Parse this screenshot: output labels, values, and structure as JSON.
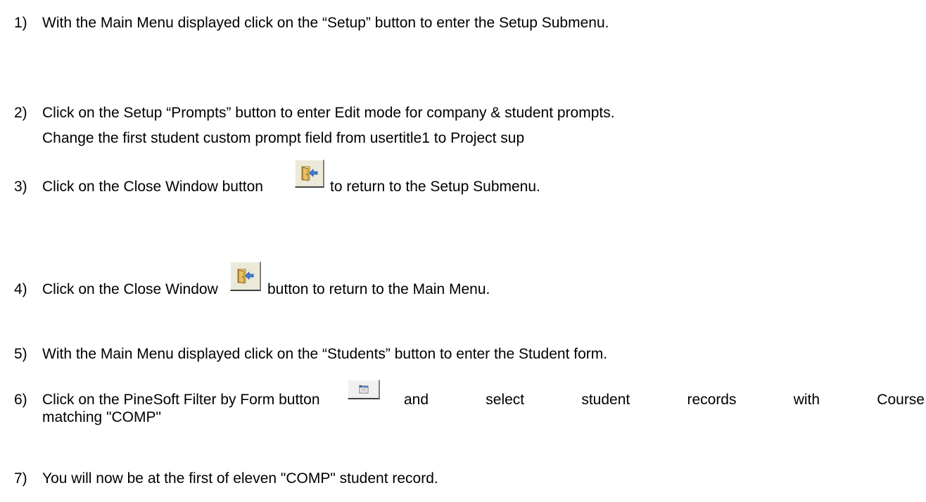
{
  "steps": [
    {
      "num": "1)",
      "text": "With the Main Menu displayed click on the “Setup” button to enter the Setup Submenu."
    },
    {
      "num": "2)",
      "text": "Click on the Setup  “Prompts” button to enter Edit mode for company & student prompts.",
      "text2": "Change the first student custom prompt field from  usertitle1  to Project sup"
    },
    {
      "num": "3)",
      "before": "Click on the Close Window button",
      "after": "to return to the Setup Submenu."
    },
    {
      "num": "4)",
      "before": "Click on the Close Window",
      "after": "button to return to the Main Menu."
    },
    {
      "num": "5)",
      "text": "With the Main Menu displayed click on the “Students” button to enter the Student form."
    },
    {
      "num": "6)",
      "before": "Click on the PineSoft Filter by Form button",
      "after": "and select student records with Course",
      "text2": "matching \"COMP\""
    },
    {
      "num": "7)",
      "text": "You will now be at the first of eleven \"COMP\" student record."
    }
  ],
  "icons": {
    "close_window": "close-window-icon",
    "filter_by_form": "filter-by-form-icon"
  }
}
